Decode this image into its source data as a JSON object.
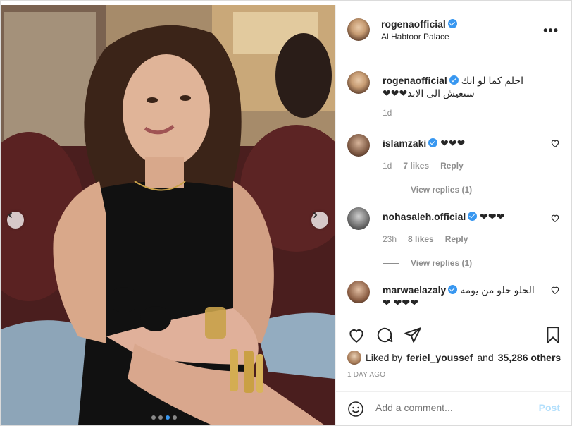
{
  "post": {
    "username": "rogenaofficial",
    "location": "Al Habtoor Palace",
    "more_icon": "more-horizontal-icon",
    "carousel": {
      "total": 4,
      "active_index": 2
    }
  },
  "caption": {
    "username": "rogenaofficial",
    "text": "احلم كما لو انك ستعيش الى الابد❤❤❤",
    "time": "1d"
  },
  "comments": [
    {
      "username": "islamzaki",
      "text": "❤❤❤",
      "time": "1d",
      "likes": "7 likes",
      "reply": "Reply",
      "view_replies": "View replies (1)"
    },
    {
      "username": "nohasaleh.official",
      "text": "❤❤❤",
      "time": "23h",
      "likes": "8 likes",
      "reply": "Reply",
      "view_replies": "View replies (1)"
    },
    {
      "username": "marwaelazaly",
      "text": "الحلو حلو من يومه ❤ ❤❤❤"
    }
  ],
  "liked_by": {
    "prefix": "Liked by",
    "user": "feriel_youssef",
    "middle": "and",
    "count": "35,286 others"
  },
  "posted_ago": "1 DAY AGO",
  "add_comment": {
    "placeholder": "Add a comment...",
    "post_label": "Post"
  },
  "colors": {
    "accent": "#3897f0",
    "post_disabled": "#b2dffc",
    "muted": "#8e8e8e"
  }
}
